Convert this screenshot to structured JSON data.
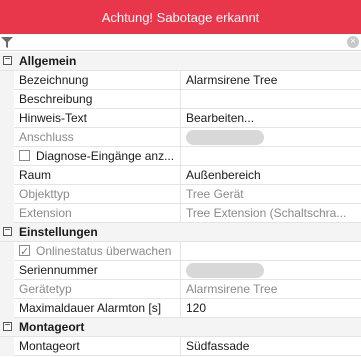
{
  "banner": {
    "text": "Achtung! Sabotage erkannt",
    "color": "#e8374a"
  },
  "filter": {
    "icon": "filter-icon",
    "clear_icon": "clear-icon",
    "clear_glyph": "×"
  },
  "categories": {
    "allgemein": "Allgemein",
    "einstellungen": "Einstellungen",
    "montageort": "Montageort",
    "toggle_glyph": "−"
  },
  "properties": {
    "bezeichnung": {
      "label": "Bezeichnung",
      "value": "Alarmsirene Tree"
    },
    "beschreibung": {
      "label": "Beschreibung",
      "value": ""
    },
    "hinweis": {
      "label": "Hinweis-Text",
      "value": "Bearbeiten..."
    },
    "anschluss": {
      "label": "Anschluss",
      "value": ""
    },
    "diagnose": {
      "label": "Diagnose-Eingänge anz...",
      "checked": false
    },
    "raum": {
      "label": "Raum",
      "value": "Außenbereich"
    },
    "objekttyp": {
      "label": "Objekttyp",
      "value": "Tree Gerät"
    },
    "extension": {
      "label": "Extension",
      "value": "Tree Extension (Schaltschra..."
    },
    "onlinestatus": {
      "label": "Onlinestatus überwachen",
      "checked": true
    },
    "seriennummer": {
      "label": "Seriennummer",
      "value": ""
    },
    "geraetetyp": {
      "label": "Gerätetyp",
      "value": "Alarmsirene Tree"
    },
    "alarmton": {
      "label": "Maximaldauer Alarmton [s]",
      "value": "120"
    },
    "montageort": {
      "label": "Montageort",
      "value": "Südfassade"
    }
  }
}
